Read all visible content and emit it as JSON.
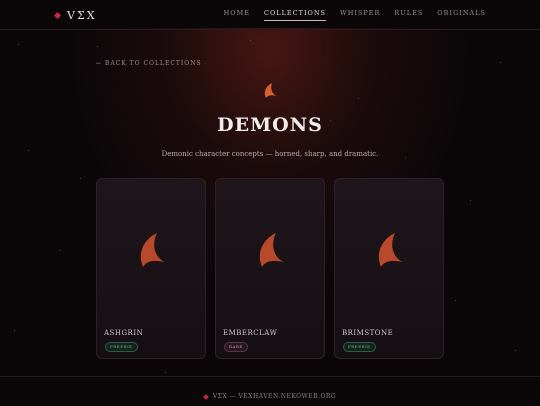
{
  "brand": {
    "name": "VΣX"
  },
  "nav": {
    "links": [
      {
        "label": "HOME",
        "active": false
      },
      {
        "label": "COLLECTIONS",
        "active": true
      },
      {
        "label": "WHISPER",
        "active": false
      },
      {
        "label": "RULES",
        "active": false
      },
      {
        "label": "ORIGINALS",
        "active": false
      }
    ]
  },
  "back_link": "← BACK TO COLLECTIONS",
  "hero": {
    "title": "DEMONS",
    "subtitle": "Demonic character concepts — horned, sharp, and dramatic.",
    "icon": "horn-icon"
  },
  "cards": [
    {
      "name": "ASHGRIN",
      "badge": "FREEBIE",
      "badge_color": "#6fae8a",
      "icon": "horn-icon"
    },
    {
      "name": "EMBERCLAW",
      "badge": "RARE",
      "badge_color": "#c59aae",
      "icon": "horn-icon"
    },
    {
      "name": "BRIMSTONE",
      "badge": "FREEBIE",
      "badge_color": "#6fae8a",
      "icon": "horn-icon"
    }
  ],
  "footer": {
    "text": "VΣX — VEXHAVEN.NEKOWEB.ORG"
  },
  "colors": {
    "accent": "#c52a47",
    "horn": "#b8492a",
    "background": "#0b0709"
  }
}
